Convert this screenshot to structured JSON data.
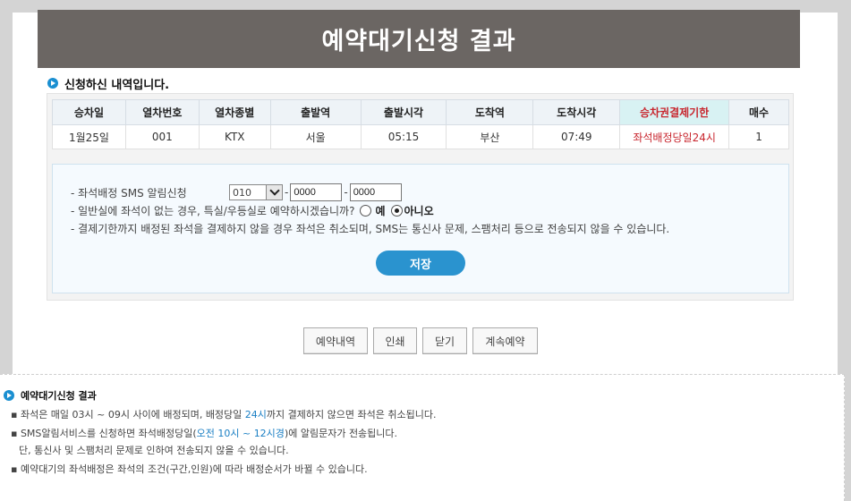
{
  "header": {
    "title": "예약대기신청 결과"
  },
  "section": {
    "title": "신청하신 내역입니다."
  },
  "table": {
    "headers": [
      "승차일",
      "열차번호",
      "열차종별",
      "출발역",
      "출발시각",
      "도착역",
      "도착시각",
      "승차권결제기한",
      "매수"
    ],
    "row": [
      "1월25일",
      "001",
      "KTX",
      "서울",
      "05:15",
      "부산",
      "07:49",
      "좌석배정당일24시",
      "1"
    ]
  },
  "options": {
    "sms_label": "- 좌석배정 SMS 알림신청",
    "phone_prefix": "010",
    "phone_mid": "0000",
    "phone_last": "0000",
    "dash": "-",
    "special_label": "- 일반실에 좌석이 없는 경우, 특실/우등실로 예약하시겠습니까?",
    "yes_label": "예",
    "no_label": "아니오",
    "notice_line": "- 결제기한까지 배정된 좌석을 결제하지 않을 경우 좌석은 취소되며, SMS는 통신사 문제, 스팸처리 등으로 전송되지 않을 수 있습니다.",
    "save_label": "저장"
  },
  "buttons": {
    "history": "예약내역",
    "print": "인쇄",
    "close": "닫기",
    "continue": "계속예약"
  },
  "notice": {
    "title": "예약대기신청 결과",
    "l1a": "▪ 좌석은 매일 03시 ~ 09시 사이에 배정되며, 배정당일 ",
    "l1b": "24시",
    "l1c": "까지 결제하지 않으면 좌석은 취소됩니다.",
    "l2a": "▪ SMS알림서비스를 신청하면 좌석배정당일(",
    "l2b": "오전 10시 ~ 12시경",
    "l2c": ")에 알림문자가 전송됩니다.",
    "l3": "단, 통신사 및 스팸처리 문제로 인하여 전송되지 않을 수 있습니다.",
    "l4": "▪ 예약대기의 좌석배정은 좌석의 조건(구간,인원)에 따라 배정순서가 바뀔 수 있습니다."
  },
  "colors": {
    "accent": "#2a93cf",
    "header_bg": "#6b6663",
    "deadline": "#c8262e"
  }
}
